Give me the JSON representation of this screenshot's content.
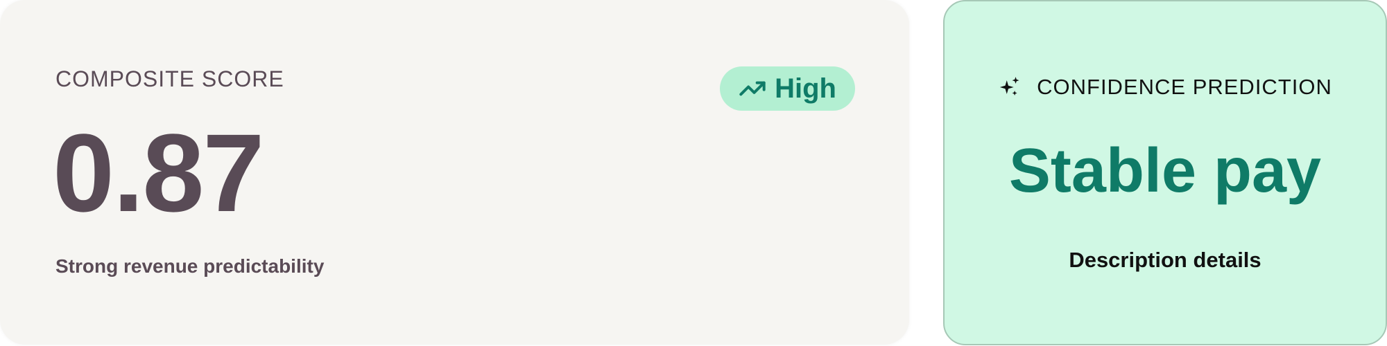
{
  "composite": {
    "label": "COMPOSITE SCORE",
    "value": "0.87",
    "subtitle": "Strong revenue predictability",
    "badge": {
      "icon": "trending-up-icon",
      "label": "High"
    }
  },
  "prediction": {
    "icon": "sparkles-icon",
    "label": "CONFIDENCE PREDICTION",
    "value": "Stable pay",
    "description": "Description details"
  },
  "colors": {
    "score_card_bg": "#f6f5f2",
    "score_text": "#594b56",
    "badge_bg": "#b3efd2",
    "accent_green": "#0f7b67",
    "prediction_card_bg": "#d0f8e4",
    "prediction_border": "#a6c8b6"
  }
}
